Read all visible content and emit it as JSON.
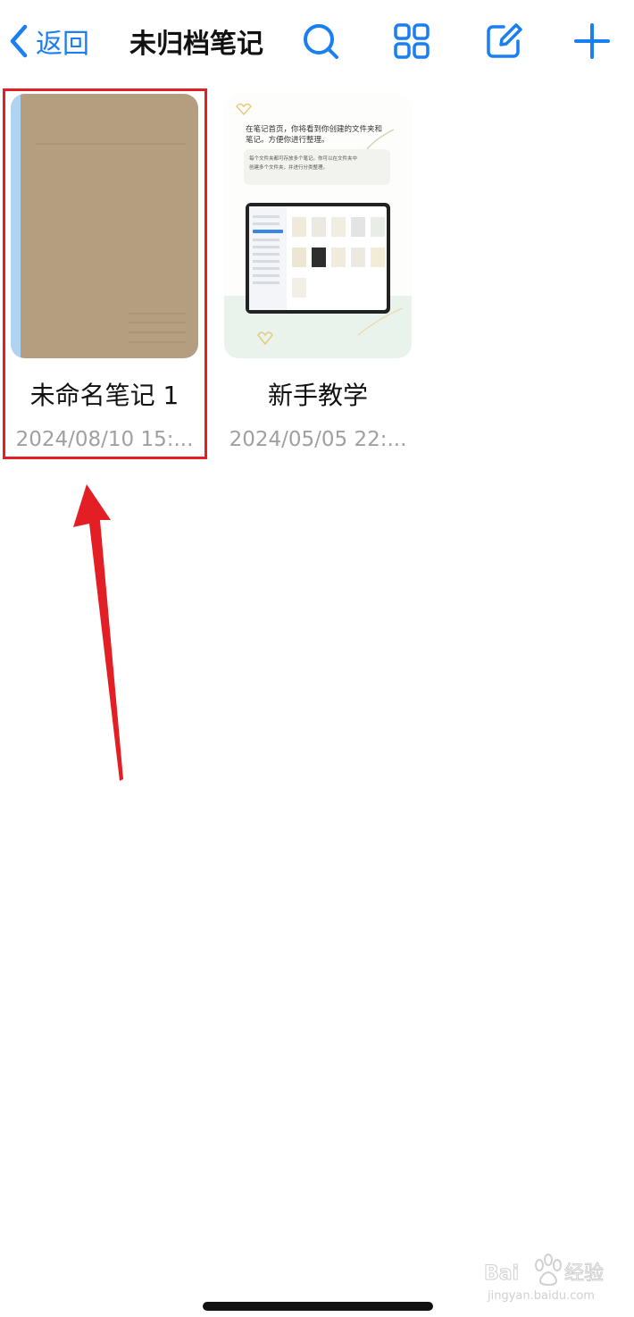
{
  "nav": {
    "back_label": "返回",
    "title": "未归档笔记",
    "icons": [
      "search-icon",
      "grid-view-icon",
      "edit-icon",
      "add-icon"
    ],
    "accent": "#1a7ff0"
  },
  "notes": [
    {
      "title": "未命名笔记 1",
      "date": "2024/08/10 15:...",
      "cover_color": "#b59e80",
      "spine_color": "#aed4f2",
      "highlighted": true
    },
    {
      "title": "新手教学",
      "date": "2024/05/05 22:...",
      "cover_text_line1": "在笔记首页，你将看到你创建的文件夹和",
      "cover_text_line2": "笔记。方便你进行整理。",
      "cover_text_box1": "每个文件夹都可存放多个笔记。你可以在文件夹中",
      "cover_text_box2": "创建多个文件夹，并进行分类整理。"
    }
  ],
  "annotation": {
    "color": "#e31e24"
  },
  "watermark": {
    "brand": "Baidu经验",
    "url": "jingyan.baidu.com"
  }
}
